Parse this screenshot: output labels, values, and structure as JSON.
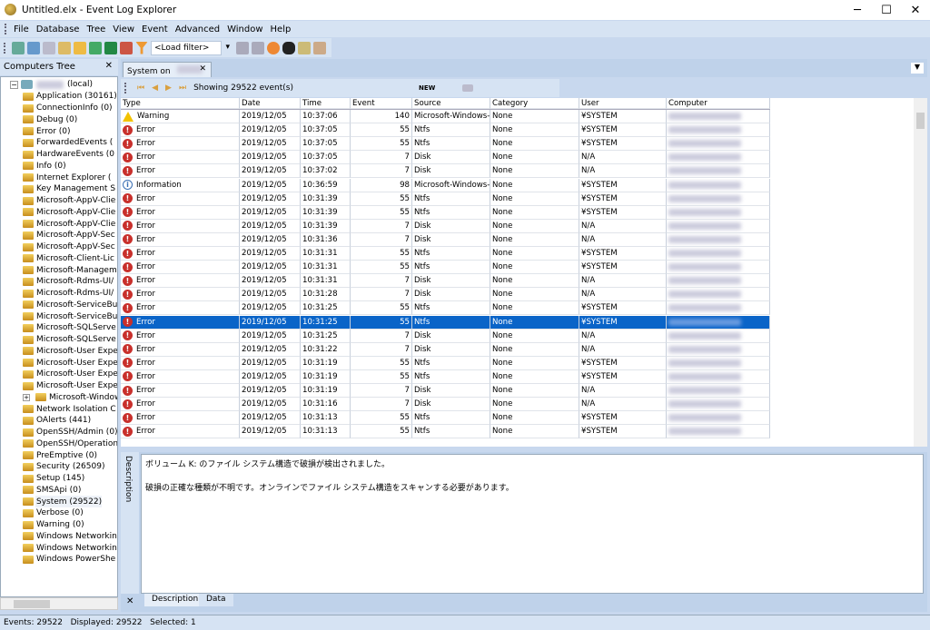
{
  "window": {
    "title": "Untitled.elx - Event Log Explorer",
    "minimize": "─",
    "maximize": "☐",
    "close": "✕"
  },
  "menu": [
    "File",
    "Database",
    "Tree",
    "View",
    "Event",
    "Advanced",
    "Window",
    "Help"
  ],
  "toolbar": {
    "filter_placeholder": "<Load filter>"
  },
  "tree": {
    "title": "Computers Tree",
    "close": "✕",
    "root": "(local)",
    "items": [
      "Application (30161)",
      "ConnectionInfo (0)",
      "Debug (0)",
      "Error (0)",
      "ForwardedEvents (",
      "HardwareEvents (0",
      "Info (0)",
      "Internet Explorer (",
      "Key Management S",
      "Microsoft-AppV-Clie",
      "Microsoft-AppV-Clie",
      "Microsoft-AppV-Clie",
      "Microsoft-AppV-Sec",
      "Microsoft-AppV-Sec",
      "Microsoft-Client-Lic",
      "Microsoft-Managem",
      "Microsoft-Rdms-UI/",
      "Microsoft-Rdms-UI/",
      "Microsoft-ServiceBu",
      "Microsoft-ServiceBu",
      "Microsoft-SQLServe",
      "Microsoft-SQLServe",
      "Microsoft-User Expe",
      "Microsoft-User Expe",
      "Microsoft-User Expe",
      "Microsoft-User Expe",
      "Microsoft-Windows",
      "Network Isolation C",
      "OAlerts (441)",
      "OpenSSH/Admin (0)",
      "OpenSSH/Operation",
      "PreEmptive (0)",
      "Security (26509)",
      "Setup (145)",
      "SMSApi (0)",
      "System (29522)",
      "Verbose (0)",
      "Warning (0)",
      "Windows Networkin",
      "Windows Networkin",
      "Windows PowerShe"
    ]
  },
  "doc_tab": {
    "label": "System on",
    "close": "✕"
  },
  "grid_toolbar": {
    "showing": "Showing 29522 event(s)",
    "new": "NEW"
  },
  "columns": [
    "Type",
    "Date",
    "Time",
    "Event",
    "Source",
    "Category",
    "User",
    "Computer"
  ],
  "rows": [
    [
      "Warning",
      "2019/12/05",
      "10:37:06",
      "140",
      "Microsoft-Windows-Nt",
      "None",
      "¥SYSTEM"
    ],
    [
      "Error",
      "2019/12/05",
      "10:37:05",
      "55",
      "Ntfs",
      "None",
      "¥SYSTEM"
    ],
    [
      "Error",
      "2019/12/05",
      "10:37:05",
      "55",
      "Ntfs",
      "None",
      "¥SYSTEM"
    ],
    [
      "Error",
      "2019/12/05",
      "10:37:05",
      "7",
      "Disk",
      "None",
      "N/A"
    ],
    [
      "Error",
      "2019/12/05",
      "10:37:02",
      "7",
      "Disk",
      "None",
      "N/A"
    ],
    [
      "Information",
      "2019/12/05",
      "10:36:59",
      "98",
      "Microsoft-Windows-Nt",
      "None",
      "¥SYSTEM"
    ],
    [
      "Error",
      "2019/12/05",
      "10:31:39",
      "55",
      "Ntfs",
      "None",
      "¥SYSTEM"
    ],
    [
      "Error",
      "2019/12/05",
      "10:31:39",
      "55",
      "Ntfs",
      "None",
      "¥SYSTEM"
    ],
    [
      "Error",
      "2019/12/05",
      "10:31:39",
      "7",
      "Disk",
      "None",
      "N/A"
    ],
    [
      "Error",
      "2019/12/05",
      "10:31:36",
      "7",
      "Disk",
      "None",
      "N/A"
    ],
    [
      "Error",
      "2019/12/05",
      "10:31:31",
      "55",
      "Ntfs",
      "None",
      "¥SYSTEM"
    ],
    [
      "Error",
      "2019/12/05",
      "10:31:31",
      "55",
      "Ntfs",
      "None",
      "¥SYSTEM"
    ],
    [
      "Error",
      "2019/12/05",
      "10:31:31",
      "7",
      "Disk",
      "None",
      "N/A"
    ],
    [
      "Error",
      "2019/12/05",
      "10:31:28",
      "7",
      "Disk",
      "None",
      "N/A"
    ],
    [
      "Error",
      "2019/12/05",
      "10:31:25",
      "55",
      "Ntfs",
      "None",
      "¥SYSTEM"
    ],
    [
      "Error",
      "2019/12/05",
      "10:31:25",
      "55",
      "Ntfs",
      "None",
      "¥SYSTEM"
    ],
    [
      "Error",
      "2019/12/05",
      "10:31:25",
      "7",
      "Disk",
      "None",
      "N/A"
    ],
    [
      "Error",
      "2019/12/05",
      "10:31:22",
      "7",
      "Disk",
      "None",
      "N/A"
    ],
    [
      "Error",
      "2019/12/05",
      "10:31:19",
      "55",
      "Ntfs",
      "None",
      "¥SYSTEM"
    ],
    [
      "Error",
      "2019/12/05",
      "10:31:19",
      "55",
      "Ntfs",
      "None",
      "¥SYSTEM"
    ],
    [
      "Error",
      "2019/12/05",
      "10:31:19",
      "7",
      "Disk",
      "None",
      "N/A"
    ],
    [
      "Error",
      "2019/12/05",
      "10:31:16",
      "7",
      "Disk",
      "None",
      "N/A"
    ],
    [
      "Error",
      "2019/12/05",
      "10:31:13",
      "55",
      "Ntfs",
      "None",
      "¥SYSTEM"
    ],
    [
      "Error",
      "2019/12/05",
      "10:31:13",
      "55",
      "Ntfs",
      "None",
      "¥SYSTEM"
    ]
  ],
  "selected_row": 15,
  "description": {
    "side_label": "Description",
    "line1": "ボリューム K: のファイル システム構造で破損が検出されました。",
    "line2": "破損の正確な種類が不明です。オンラインでファイル システム構造をスキャンする必要があります。",
    "tabs": [
      "Description",
      "Data"
    ],
    "close": "✕"
  },
  "status": "Events: 29522   Displayed: 29522   Selected: 1"
}
